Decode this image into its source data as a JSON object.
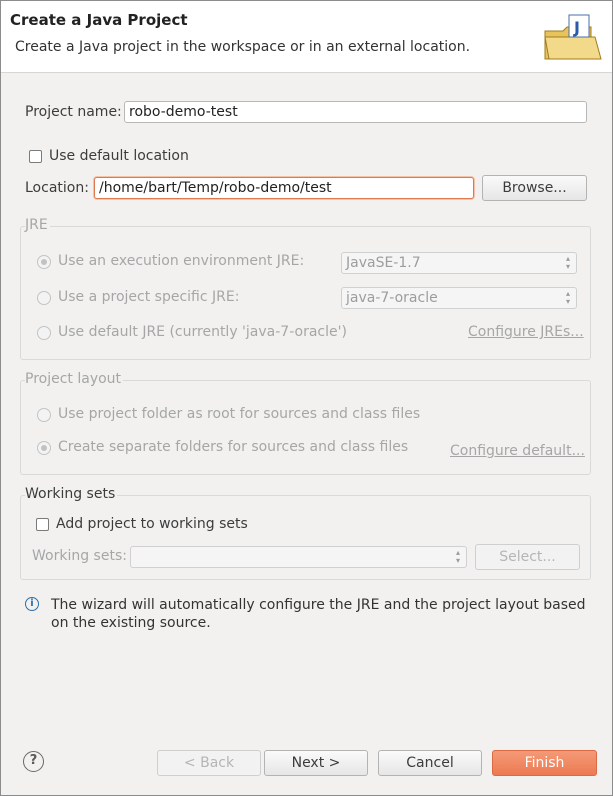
{
  "header": {
    "title": "Create a Java Project",
    "subtitle": "Create a Java project in the workspace or in an external location.",
    "icon": "java-project-folder-icon"
  },
  "project": {
    "name_label": "Project name:",
    "name_value": "robo-demo-test",
    "use_default_location_label": "Use default location",
    "use_default_location_checked": false,
    "location_label": "Location:",
    "location_value": "/home/bart/Temp/robo-demo/test",
    "browse_label": "Browse..."
  },
  "jre": {
    "group_label": "JRE",
    "option_env_label": "Use an execution environment JRE:",
    "option_env_value": "JavaSE-1.7",
    "option_specific_label": "Use a project specific JRE:",
    "option_specific_value": "java-7-oracle",
    "option_default_label": "Use default JRE (currently 'java-7-oracle')",
    "configure_link": "Configure JREs..."
  },
  "layout": {
    "group_label": "Project layout",
    "option_root_label": "Use project folder as root for sources and class files",
    "option_separate_label": "Create separate folders for sources and class files",
    "configure_link": "Configure default..."
  },
  "working_sets": {
    "group_label": "Working sets",
    "add_label": "Add project to working sets",
    "add_checked": false,
    "sets_label": "Working sets:",
    "sets_value": "",
    "select_label": "Select..."
  },
  "info": {
    "message": "The wizard will automatically configure the JRE and the project layout based on the existing source."
  },
  "footer": {
    "back_label": "< Back",
    "next_label": "Next >",
    "cancel_label": "Cancel",
    "finish_label": "Finish"
  },
  "colors": {
    "accent": "#ed7a52",
    "focus_border": "#e07a4e",
    "info_blue": "#2c6ea8"
  }
}
